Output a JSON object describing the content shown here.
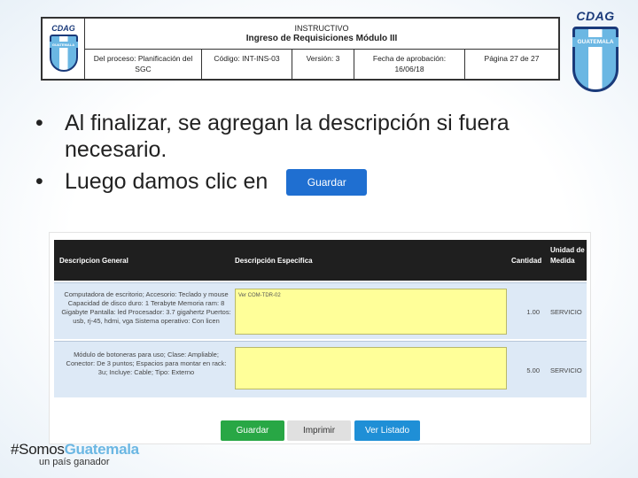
{
  "header": {
    "logo_text": "CDAG",
    "logo_band": "GUATEMALA",
    "line1": "INSTRUCTIVO",
    "line2": "Ingreso de Requisiciones Módulo III",
    "cells": [
      {
        "text": "Del proceso: Planificación del SGC"
      },
      {
        "text": "Código: INT-INS-03"
      },
      {
        "text": "Versión: 3"
      },
      {
        "text": "Fecha de aprobación: 16/06/18"
      },
      {
        "text": "Página 27 de 27"
      }
    ]
  },
  "brand_logo": {
    "text": "CDAG",
    "band": "GUATEMALA"
  },
  "bullets": [
    {
      "text": "Al finalizar, se agregan la descripción si fuera necesario."
    },
    {
      "text": "Luego damos clic en",
      "button_label": "Guardar"
    }
  ],
  "form": {
    "columns": [
      "Descripcion General",
      "Descripción Especifica",
      "Cantidad",
      "Unidad de Medida"
    ],
    "rows": [
      {
        "general": "Computadora de escritorio; Accesorio: Teclado y mouse Capacidad de disco duro: 1 Terabyte Memoria ram: 8 Gigabyte Pantalla: led Procesador: 3.7 gigahertz Puertos: usb, rj-45, hdmi, vga Sistema operativo: Con licen",
        "specific": "Ver COM-TDR-02",
        "qty": "1.00",
        "unit": "SERVICIO"
      },
      {
        "general": "Módulo de botoneras para uso; Clase: Ampliable; Conector: De 3 puntos; Espacios para montar en rack: 3u; Incluye: Cable; Tipo: Externo",
        "specific": "",
        "qty": "5.00",
        "unit": "SERVICIO"
      }
    ],
    "buttons": [
      {
        "label": "Guardar",
        "color": "#28a745"
      },
      {
        "label": "Imprimir",
        "color": "#e0e0e0"
      },
      {
        "label": "Ver Listado",
        "color": "#1f8fd6"
      }
    ]
  },
  "footer": {
    "hash_prefix": "#Somos",
    "hash_highlight": "Guatemala",
    "tagline": "un país ganador"
  }
}
